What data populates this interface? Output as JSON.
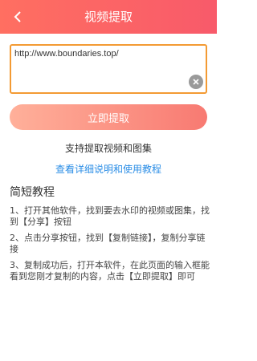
{
  "header": {
    "title": "视频提取",
    "back_icon": "chevron-left-icon",
    "gradient_start": "#ff6f61",
    "gradient_end": "#f85a6a"
  },
  "input": {
    "value": "http://www.boundaries.top/",
    "border_color": "#f39a33",
    "clear_icon": "clear-circle-icon"
  },
  "extract_button": {
    "label": "立即提取"
  },
  "support_text": "支持提取视频和图集",
  "detail_link": {
    "label": "查看详细说明和使用教程",
    "color": "#2a8de6"
  },
  "tutorial": {
    "title": "简短教程",
    "steps": [
      "1、打开其他软件，找到要去水印的视频或图集，找到【分享】按钮",
      "2、点击分享按钮，找到【复制链接】，复制分享链接",
      "3、复制成功后，打开本软件，在此页面的输入框能看到您刚才复制的内容，点击【立即提取】即可"
    ]
  }
}
